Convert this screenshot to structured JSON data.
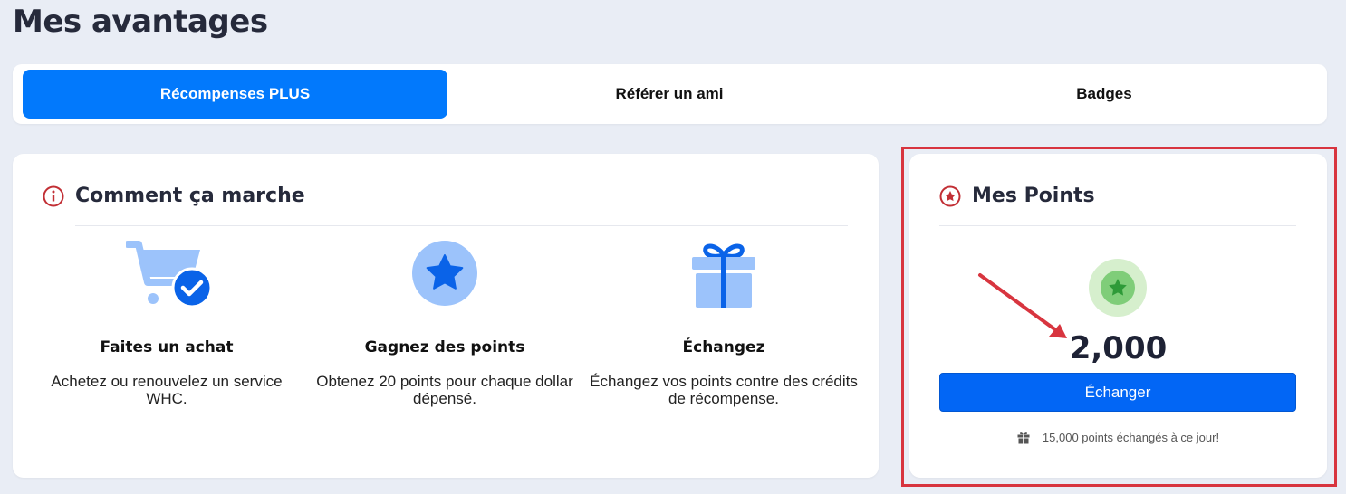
{
  "page": {
    "title": "Mes avantages"
  },
  "tabs": [
    {
      "label": "Récompenses PLUS",
      "active": true
    },
    {
      "label": "Référer un ami",
      "active": false
    },
    {
      "label": "Badges",
      "active": false
    }
  ],
  "how_it_works": {
    "title": "Comment ça marche",
    "icon": "info-circle-icon",
    "steps": [
      {
        "icon": "cart-check-icon",
        "title": "Faites un achat",
        "text": "Achetez ou renouvelez un service WHC."
      },
      {
        "icon": "star-circle-icon",
        "title": "Gagnez des points",
        "text": "Obtenez 20 points pour chaque dollar dépensé."
      },
      {
        "icon": "gift-icon",
        "title": "Échangez",
        "text": "Échangez vos points contre des crédits de récompense."
      }
    ]
  },
  "points": {
    "title": "Mes Points",
    "icon": "star-badge-icon",
    "value": "2,000",
    "redeem_label": "Échanger",
    "redeemed_note": "15,000 points échangés à ce jour!"
  },
  "colors": {
    "accent": "#0279fc",
    "button": "#0266f5",
    "highlight": "#d8353f",
    "icon_light": "#9cc3fb",
    "icon_dark": "#0a63e8",
    "coin_outer": "#d6efcd",
    "coin_inner": "#7fcd79"
  }
}
